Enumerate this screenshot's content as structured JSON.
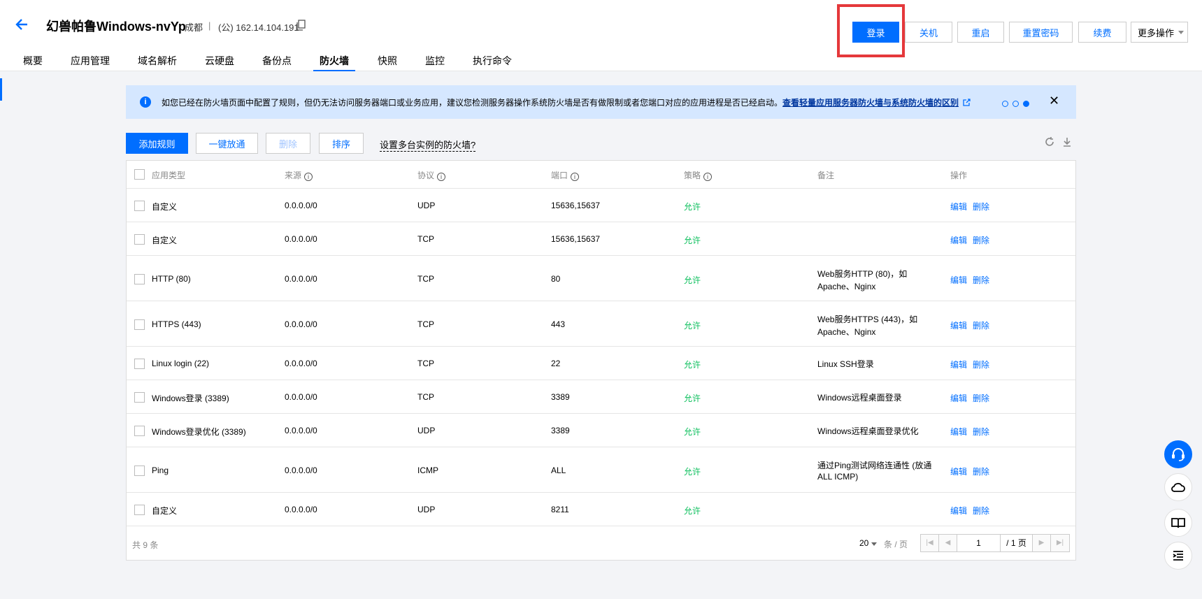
{
  "header": {
    "title": "幻兽帕鲁Windows-nvYp",
    "region": "成都",
    "separator": "|",
    "ip": "(公) 162.14.104.191"
  },
  "actions": {
    "login": "登录",
    "shutdown": "关机",
    "restart": "重启",
    "reset_password": "重置密码",
    "renew": "续费",
    "more": "更多操作"
  },
  "tabs": [
    "概要",
    "应用管理",
    "域名解析",
    "云硬盘",
    "备份点",
    "防火墙",
    "快照",
    "监控",
    "执行命令"
  ],
  "notice": {
    "text": "如您已经在防火墙页面中配置了规则，但仍无法访问服务器端口或业务应用，建议您检测服务器操作系统防火墙是否有做限制或者您端口对应的应用进程是否已经启动。",
    "link": "查看轻量应用服务器防火墙与系统防火墙的区别"
  },
  "toolbar": {
    "add": "添加规则",
    "open_all": "一键放通",
    "delete": "删除",
    "sort": "排序",
    "multi": "设置多台实例的防火墙?"
  },
  "table": {
    "headers": [
      "应用类型",
      "来源",
      "协议",
      "端口",
      "策略",
      "备注",
      "操作"
    ],
    "rows": [
      {
        "type": "自定义",
        "source": "0.0.0.0/0",
        "protocol": "UDP",
        "port": "15636,15637",
        "policy": "允许",
        "note1": "",
        "note2": ""
      },
      {
        "type": "自定义",
        "source": "0.0.0.0/0",
        "protocol": "TCP",
        "port": "15636,15637",
        "policy": "允许",
        "note1": "",
        "note2": ""
      },
      {
        "type": "HTTP (80)",
        "source": "0.0.0.0/0",
        "protocol": "TCP",
        "port": "80",
        "policy": "允许",
        "note1": "Web服务HTTP (80)，如",
        "note2": "Apache、Nginx"
      },
      {
        "type": "HTTPS (443)",
        "source": "0.0.0.0/0",
        "protocol": "TCP",
        "port": "443",
        "policy": "允许",
        "note1": "Web服务HTTPS (443)，如",
        "note2": "Apache、Nginx"
      },
      {
        "type": "Linux login (22)",
        "source": "0.0.0.0/0",
        "protocol": "TCP",
        "port": "22",
        "policy": "允许",
        "note1": "Linux SSH登录",
        "note2": ""
      },
      {
        "type": "Windows登录 (3389)",
        "source": "0.0.0.0/0",
        "protocol": "TCP",
        "port": "3389",
        "policy": "允许",
        "note1": "Windows远程桌面登录",
        "note2": ""
      },
      {
        "type": "Windows登录优化 (3389)",
        "source": "0.0.0.0/0",
        "protocol": "UDP",
        "port": "3389",
        "policy": "允许",
        "note1": "Windows远程桌面登录优化",
        "note2": ""
      },
      {
        "type": "Ping",
        "source": "0.0.0.0/0",
        "protocol": "ICMP",
        "port": "ALL",
        "policy": "允许",
        "note1": "通过Ping测试网络连通性 (放通",
        "note2": "ALL ICMP)"
      },
      {
        "type": "自定义",
        "source": "0.0.0.0/0",
        "protocol": "UDP",
        "port": "8211",
        "policy": "允许",
        "note1": "",
        "note2": ""
      }
    ],
    "edit": "编辑",
    "remove": "删除"
  },
  "footer": {
    "total": "共 9 条",
    "page_size": "20",
    "per_page": "条 / 页",
    "current_page": "1",
    "total_pages": "/ 1 页"
  }
}
